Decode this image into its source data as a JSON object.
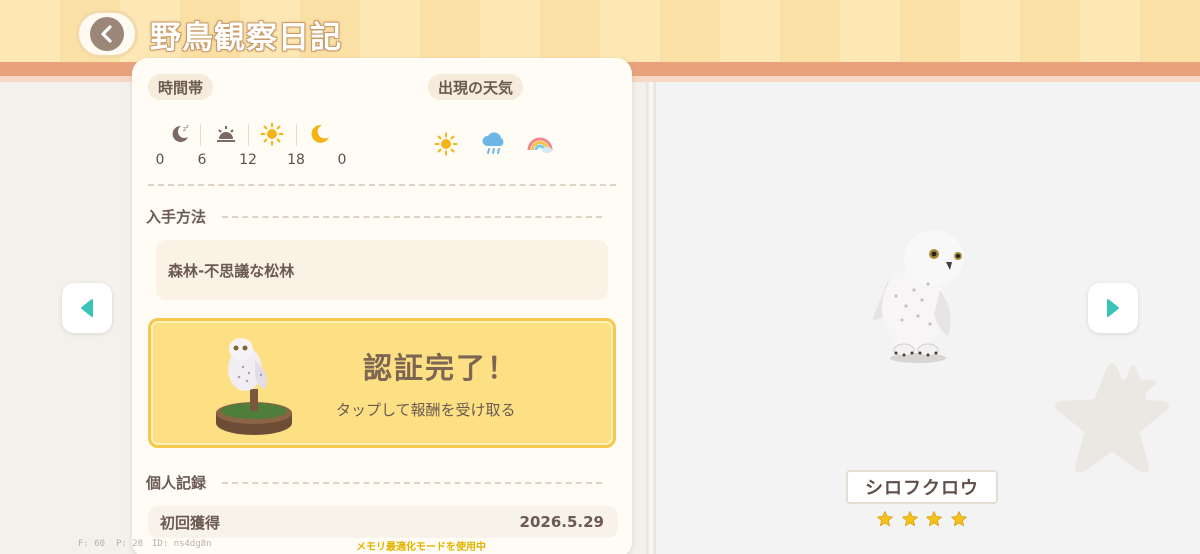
{
  "header": {
    "title": "野鳥観察日記",
    "back_icon": "chevron-left-icon"
  },
  "colors": {
    "header_bg": "#fde7b4",
    "header_strip": "#e8a37d",
    "certify_box": "#fde084",
    "nav_arrow": "#3cc3b5",
    "star": "#f5c21b"
  },
  "time_of_day": {
    "label": "時間帯",
    "icons": [
      "sleeping-moon-icon",
      "sunrise-icon",
      "sun-icon",
      "crescent-moon-icon"
    ],
    "hours": [
      "0",
      "6",
      "12",
      "18",
      "0"
    ]
  },
  "weather": {
    "label": "出現の天気",
    "icons": [
      "sunny-icon",
      "rain-icon",
      "rainbow-icon"
    ]
  },
  "acquisition": {
    "label": "入手方法",
    "method": "森林-不思議な松林"
  },
  "certification": {
    "title": "認証完了！",
    "subtitle": "タップして報酬を受け取る"
  },
  "personal_record": {
    "label": "個人記録",
    "rows": [
      {
        "label": "初回獲得",
        "value": "2026.5.29"
      }
    ]
  },
  "bird": {
    "name": "シロフクロウ",
    "rarity_stars": 4
  },
  "footer": {
    "fps": "F: 60",
    "ping": "P: 28",
    "id": "ID: ns4dg8n",
    "notice": "メモリ最適化モードを使用中"
  }
}
